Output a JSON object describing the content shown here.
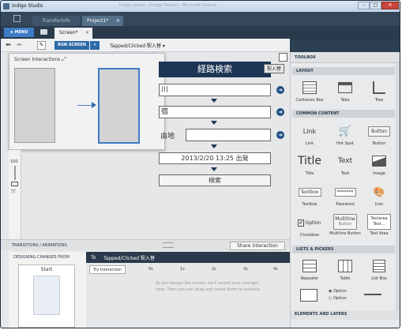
{
  "window": {
    "title": "Indigo Studio",
    "faded_caption": "Indigo Studio - [Indigo Studio] - Microsoft Outlook"
  },
  "tabs": [
    {
      "label": "TransferInfo"
    },
    {
      "label": "Project1*"
    }
  ],
  "menubar": {
    "menu_label": "≡ MENU",
    "screen_tab": "Screen*"
  },
  "toolbar": {
    "run_label": "RUN SCREEN",
    "state_label": "Tapped/Clicked 駅入替"
  },
  "interactions_popup": {
    "title": "Screen Interactions"
  },
  "zoom": {
    "value": "100"
  },
  "screen": {
    "title": "経路検索",
    "swap_button": "駅入替",
    "from_text": "川",
    "to_text": "宿",
    "via_label": "由地",
    "datetime": "2013/2/20 13:25 出発",
    "search_button": "検索"
  },
  "toolbox": {
    "title": "TOOLBOX",
    "sections": {
      "layout": "LAYOUT",
      "common": "COMMON CONTENT",
      "lists": "LISTS & PICKERS",
      "elements": "ELEMENTS AND LAYERS"
    },
    "layout_items": [
      "Container Box",
      "Tabs",
      "Tree"
    ],
    "common_items": [
      "Link",
      "Hot Spot",
      "Button",
      "Title",
      "Text",
      "Image",
      "Textbox",
      "Password",
      "Icon",
      "Checkbox",
      "Multiline Button",
      "Text Area"
    ],
    "list_items": [
      "Repeater",
      "Table",
      "List Box"
    ],
    "samples": {
      "link": "Link",
      "button": "Button",
      "title": "Title",
      "text": "Text",
      "textbox": "Textbox",
      "password": "*******",
      "option": "Option",
      "multiline_top": "Multiline",
      "multiline_bottom": "Button",
      "textarea_top": "Textarea",
      "textarea_bottom": "Text..."
    }
  },
  "bottom": {
    "header": "TRANSITIONS / ANIMATIONS",
    "share_label": "Share Interaction",
    "designing_label": "DESIGNING CHANGES FROM",
    "to_label": "To",
    "to_state": "Tapped/Clicked 駅入替",
    "try_label": "Try Interaction",
    "start_label": "Start",
    "ticks": [
      "0s",
      "1s",
      "2s",
      "3s",
      "4s"
    ],
    "hint_line1": "As you design the screen, we'll record your changes",
    "hint_line2": "here.  Then you can drag and resize them to animate."
  }
}
